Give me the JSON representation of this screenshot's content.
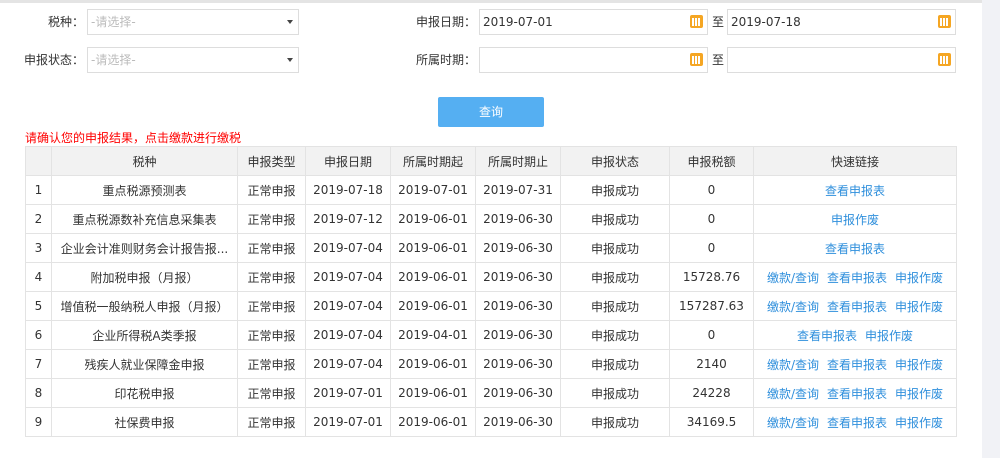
{
  "filters": {
    "tax_type_label": "税种：",
    "tax_type_placeholder": "-请选择-",
    "status_label": "申报状态：",
    "status_placeholder": "-请选择-",
    "decl_date_label": "申报日期：",
    "decl_date_from": "2019-07-01",
    "decl_date_to": "2019-07-18",
    "period_label": "所属时期：",
    "period_from": "",
    "period_to": "",
    "to_label": "至"
  },
  "query_button": "查询",
  "notice": "请确认您的申报结果，点击缴款进行缴税",
  "table": {
    "headers": [
      "",
      "税种",
      "申报类型",
      "申报日期",
      "所属时期起",
      "所属时期止",
      "申报状态",
      "申报税额",
      "快速链接"
    ],
    "rows": [
      {
        "no": "1",
        "tax": "重点税源预测表",
        "type": "正常申报",
        "date": "2019-07-18",
        "start": "2019-07-01",
        "end": "2019-07-31",
        "status": "申报成功",
        "amount": "0",
        "links": [
          "查看申报表"
        ]
      },
      {
        "no": "2",
        "tax": "重点税源数补充信息采集表",
        "type": "正常申报",
        "date": "2019-07-12",
        "start": "2019-06-01",
        "end": "2019-06-30",
        "status": "申报成功",
        "amount": "0",
        "links": [
          "申报作废"
        ]
      },
      {
        "no": "3",
        "tax": "企业会计准则财务会计报告报...",
        "type": "正常申报",
        "date": "2019-07-04",
        "start": "2019-06-01",
        "end": "2019-06-30",
        "status": "申报成功",
        "amount": "0",
        "links": [
          "查看申报表"
        ]
      },
      {
        "no": "4",
        "tax": "附加税申报（月报）",
        "type": "正常申报",
        "date": "2019-07-04",
        "start": "2019-06-01",
        "end": "2019-06-30",
        "status": "申报成功",
        "amount": "15728.76",
        "links": [
          "缴款/查询",
          "查看申报表",
          "申报作废"
        ]
      },
      {
        "no": "5",
        "tax": "增值税一般纳税人申报（月报）",
        "type": "正常申报",
        "date": "2019-07-04",
        "start": "2019-06-01",
        "end": "2019-06-30",
        "status": "申报成功",
        "amount": "157287.63",
        "links": [
          "缴款/查询",
          "查看申报表",
          "申报作废"
        ]
      },
      {
        "no": "6",
        "tax": "企业所得税A类季报",
        "type": "正常申报",
        "date": "2019-07-04",
        "start": "2019-04-01",
        "end": "2019-06-30",
        "status": "申报成功",
        "amount": "0",
        "links": [
          "查看申报表",
          "申报作废"
        ]
      },
      {
        "no": "7",
        "tax": "残疾人就业保障金申报",
        "type": "正常申报",
        "date": "2019-07-04",
        "start": "2019-06-01",
        "end": "2019-06-30",
        "status": "申报成功",
        "amount": "2140",
        "links": [
          "缴款/查询",
          "查看申报表",
          "申报作废"
        ]
      },
      {
        "no": "8",
        "tax": "印花税申报",
        "type": "正常申报",
        "date": "2019-07-01",
        "start": "2019-06-01",
        "end": "2019-06-30",
        "status": "申报成功",
        "amount": "24228",
        "links": [
          "缴款/查询",
          "查看申报表",
          "申报作废"
        ]
      },
      {
        "no": "9",
        "tax": "社保费申报",
        "type": "正常申报",
        "date": "2019-07-01",
        "start": "2019-06-01",
        "end": "2019-06-30",
        "status": "申报成功",
        "amount": "34169.5",
        "links": [
          "缴款/查询",
          "查看申报表",
          "申报作废"
        ]
      }
    ]
  },
  "colors": {
    "accent": "#55aff2",
    "link": "#2f8fdc",
    "notice": "#ff0000",
    "calendar": "#f5a623"
  }
}
